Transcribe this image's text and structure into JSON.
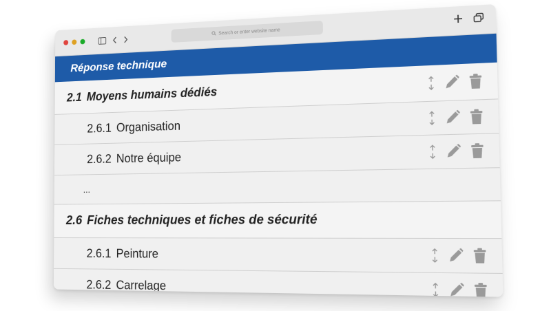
{
  "browser": {
    "address_placeholder": "Search or enter website name"
  },
  "header": {
    "title": "Réponse technique"
  },
  "sections": [
    {
      "number": "2.1",
      "title": "Moyens humains dédiés",
      "items": [
        {
          "number": "2.6.1",
          "title": "Organisation"
        },
        {
          "number": "2.6.2",
          "title": "Notre équipe"
        }
      ],
      "more": "..."
    },
    {
      "number": "2.6",
      "title": "Fiches techniques et fiches de sécurité",
      "items": [
        {
          "number": "2.6.1",
          "title": "Peinture"
        },
        {
          "number": "2.6.2",
          "title": "Carrelage"
        }
      ]
    }
  ],
  "icons": {
    "move": "move-up-down-icon",
    "edit": "pencil-icon",
    "delete": "trash-icon"
  },
  "colors": {
    "header_band": "#1e5ba8",
    "icon_gray": "#9a9a9a",
    "traffic_red": "#e0443e",
    "traffic_yellow": "#dea123",
    "traffic_green": "#1aab29"
  }
}
